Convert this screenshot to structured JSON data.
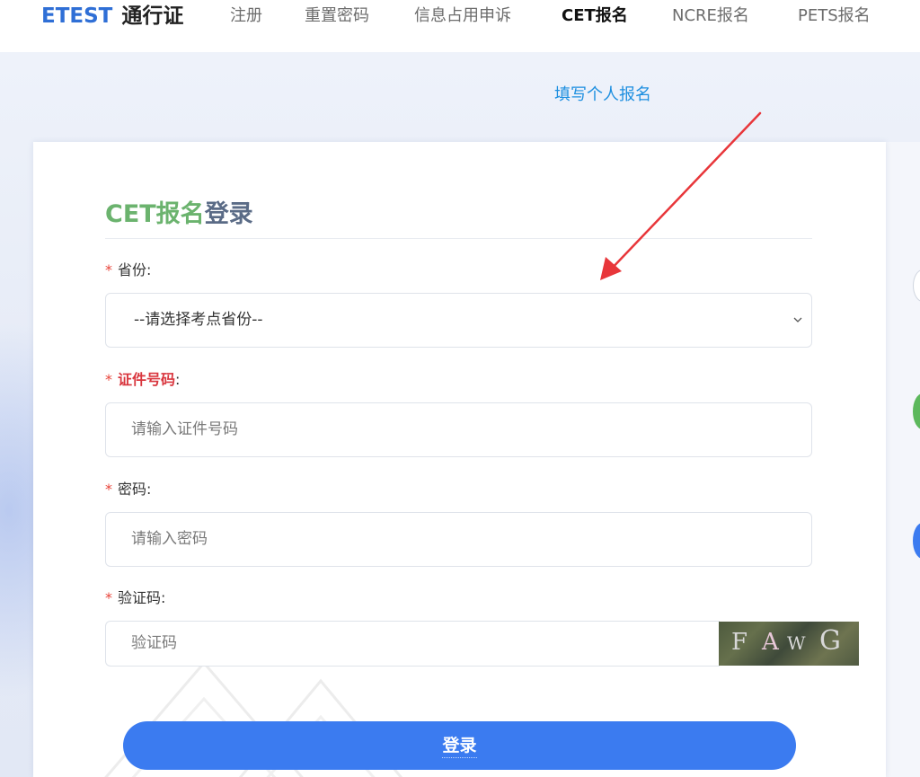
{
  "nav": {
    "brand_main": "ETEST",
    "brand_sub": "通行证",
    "items": [
      {
        "label": "注册",
        "active": false
      },
      {
        "label": "重置密码",
        "active": false
      },
      {
        "label": "信息占用申诉",
        "active": false
      },
      {
        "label": "CET报名",
        "active": true
      },
      {
        "label": "NCRE报名",
        "active": false
      },
      {
        "label": "PETS报名",
        "active": false
      }
    ]
  },
  "hero": {
    "personal_link": "填写个人报名"
  },
  "form": {
    "title_part1": "CET报名",
    "title_part2": "登录",
    "required_mark": "*",
    "province": {
      "label": "省份:",
      "selected": "--请选择考点省份--"
    },
    "id_number": {
      "label": "证件号码",
      "colon": ":",
      "placeholder": "请输入证件号码"
    },
    "password": {
      "label": "密码:",
      "placeholder": "请输入密码"
    },
    "captcha": {
      "label": "验证码:",
      "placeholder": "验证码",
      "image_chars": [
        "F",
        "A",
        "W",
        "G"
      ]
    },
    "login_button": "登录"
  },
  "colors": {
    "brand_blue": "#2f6fd6",
    "title_green": "#6bb36e",
    "title_slate": "#5a6b86",
    "required_red": "#e8443a",
    "link_blue": "#1d8fe0",
    "button_blue": "#3b7bf0",
    "arrow_red": "#e8363a"
  },
  "icons": {
    "select_chevron": "chevron-down-icon"
  }
}
